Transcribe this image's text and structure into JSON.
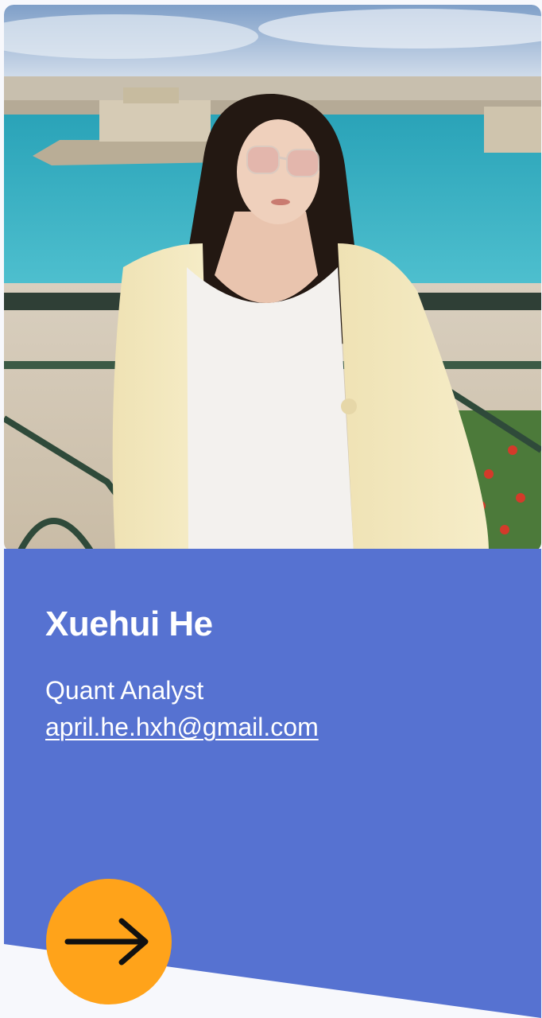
{
  "profile": {
    "name": "Xuehui He",
    "role": "Quant Analyst",
    "email": "april.he.hxh@gmail.com"
  },
  "colors": {
    "panel": "#5672d1",
    "accent": "#ffa31a",
    "background": "#f7f8fc",
    "text": "#ffffff"
  },
  "icons": {
    "next": "arrow-right-icon"
  }
}
